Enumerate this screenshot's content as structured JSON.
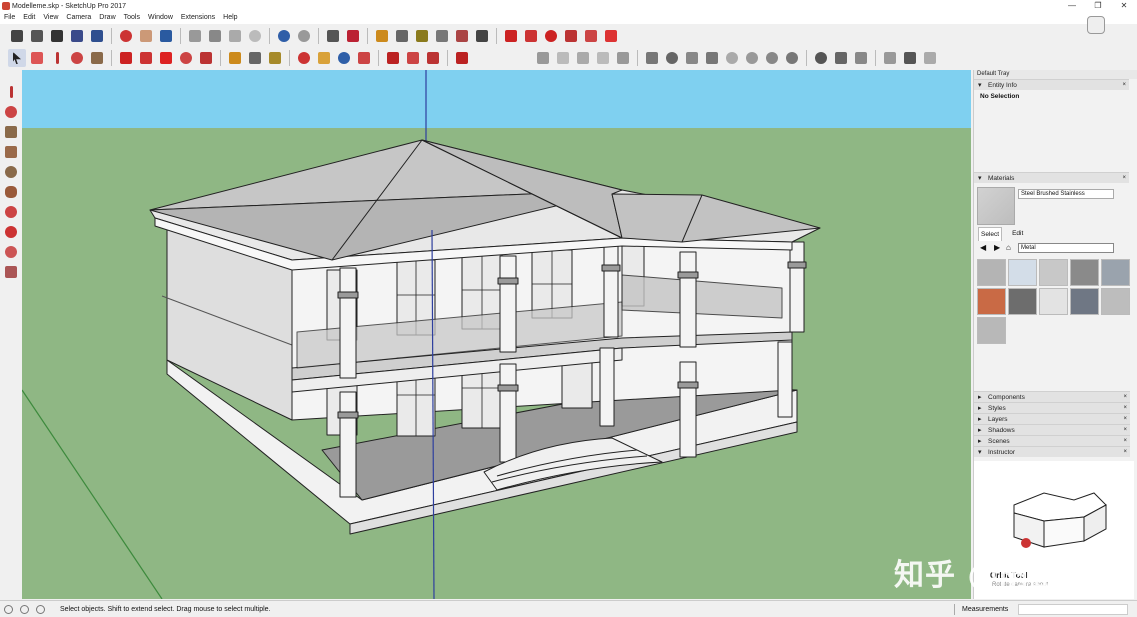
{
  "window": {
    "title": "Modelleme.skp - SketchUp Pro 2017",
    "controls": [
      "—",
      "❐",
      "✕"
    ]
  },
  "menu": [
    "File",
    "Edit",
    "View",
    "Camera",
    "Draw",
    "Tools",
    "Window",
    "Extensions",
    "Help"
  ],
  "tray": {
    "title": "Default Tray",
    "entity_info": {
      "header": "Entity Info",
      "selection": "No Selection"
    },
    "materials": {
      "header": "Materials",
      "current_material": "Steel Brushed Stainless",
      "tabs": [
        "Select",
        "Edit"
      ],
      "library": "Metal",
      "swatch_colors": [
        "#b4b4b4",
        "#d3dde8",
        "#c8c8c8",
        "#8a8a8a",
        "#9aa3ad",
        "#c96a45",
        "#6d6d6d",
        "#e3e3e3",
        "#6f7784",
        "#bdbdbd",
        "#b8b8b8"
      ]
    },
    "panels": [
      "Components",
      "Styles",
      "Layers",
      "Shadows",
      "Scenes",
      "Instructor"
    ],
    "instructor": {
      "title": "Orbit Tool",
      "description": "Rotate camera about"
    }
  },
  "status": {
    "message": "Select objects. Shift to extend select. Drag mouse to select multiple.",
    "measurements_label": "Measurements",
    "measurements_value": ""
  },
  "watermark": "知乎 @雨歪歪",
  "colors": {
    "sky": "#7fd0f0",
    "ground": "#8fb784",
    "red_axis": "#c0392b",
    "blue_axis": "#2e3f9e",
    "green_axis": "#3d8a3d"
  }
}
